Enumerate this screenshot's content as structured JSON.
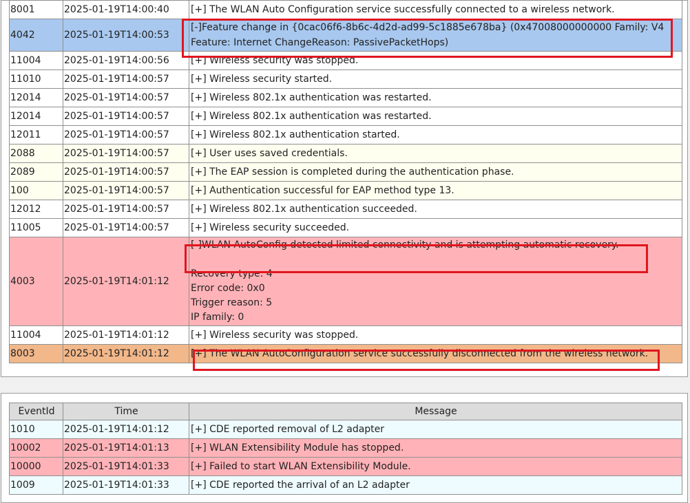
{
  "top_table": {
    "rows": [
      {
        "id": "8001",
        "time": "2025-01-19T14:00:40",
        "message": "[+] The WLAN Auto Configuration service successfully connected to a wireless network.",
        "color": "white"
      },
      {
        "id": "4042",
        "time": "2025-01-19T14:00:53",
        "message": "[-]Feature change in {0cac06f6-8b6c-4d2d-ad99-5c1885e678ba} (0x47008000000000 Family: V4 Feature: Internet ChangeReason: PassivePacketHops)",
        "color": "blue"
      },
      {
        "id": "11004",
        "time": "2025-01-19T14:00:56",
        "message": "[+] Wireless security was stopped.",
        "color": "white"
      },
      {
        "id": "11010",
        "time": "2025-01-19T14:00:57",
        "message": "[+] Wireless security started.",
        "color": "white"
      },
      {
        "id": "12014",
        "time": "2025-01-19T14:00:57",
        "message": "[+] Wireless 802.1x authentication was restarted.",
        "color": "white"
      },
      {
        "id": "12014",
        "time": "2025-01-19T14:00:57",
        "message": "[+] Wireless 802.1x authentication was restarted.",
        "color": "white"
      },
      {
        "id": "12011",
        "time": "2025-01-19T14:00:57",
        "message": "[+] Wireless 802.1x authentication started.",
        "color": "white"
      },
      {
        "id": "2088",
        "time": "2025-01-19T14:00:57",
        "message": "[+] User uses saved credentials.",
        "color": "yellow"
      },
      {
        "id": "2089",
        "time": "2025-01-19T14:00:57",
        "message": "[+] The EAP session is completed during the authentication phase.",
        "color": "yellow"
      },
      {
        "id": "100",
        "time": "2025-01-19T14:00:57",
        "message": "[+] Authentication successful for EAP method type 13.",
        "color": "yellow"
      },
      {
        "id": "12012",
        "time": "2025-01-19T14:00:57",
        "message": "[+] Wireless 802.1x authentication succeeded.",
        "color": "white"
      },
      {
        "id": "11005",
        "time": "2025-01-19T14:00:57",
        "message": "[+] Wireless security succeeded.",
        "color": "white"
      },
      {
        "id": "4003",
        "time": "2025-01-19T14:01:12",
        "message": "[-]WLAN AutoConfig detected limited connectivity and is attempting automatic recovery.",
        "details": [
          "Recovery type: 4",
          "Error code: 0x0",
          "Trigger reason: 5",
          "IP family: 0"
        ],
        "color": "pink"
      },
      {
        "id": "11004",
        "time": "2025-01-19T14:01:12",
        "message": "[+] Wireless security was stopped.",
        "color": "white"
      },
      {
        "id": "8003",
        "time": "2025-01-19T14:01:12",
        "message": "[+] The WLAN AutoConfiguration service successfully disconnected from the wireless network.",
        "color": "orange"
      }
    ]
  },
  "bottom_table": {
    "headers": {
      "id": "EventId",
      "time": "Time",
      "message": "Message"
    },
    "rows": [
      {
        "id": "1010",
        "time": "2025-01-19T14:01:12",
        "message": "[+] CDE reported removal of L2 adapter",
        "color": "cyan"
      },
      {
        "id": "10002",
        "time": "2025-01-19T14:01:13",
        "message": "[+] WLAN Extensibility Module has stopped.",
        "color": "pink"
      },
      {
        "id": "10000",
        "time": "2025-01-19T14:01:33",
        "message": "[+] Failed to start WLAN Extensibility Module.",
        "color": "pink"
      },
      {
        "id": "1009",
        "time": "2025-01-19T14:01:33",
        "message": "[+] CDE reported the arrival of an L2 adapter",
        "color": "cyan"
      }
    ]
  },
  "row_colors": {
    "white": "#ffffff",
    "blue": "#a8c8ef",
    "yellow": "#fffff0",
    "pink": "#ffb3b8",
    "orange": "#f2b88a",
    "cyan": "#eefcff",
    "highlight_box": "#e0161f"
  }
}
